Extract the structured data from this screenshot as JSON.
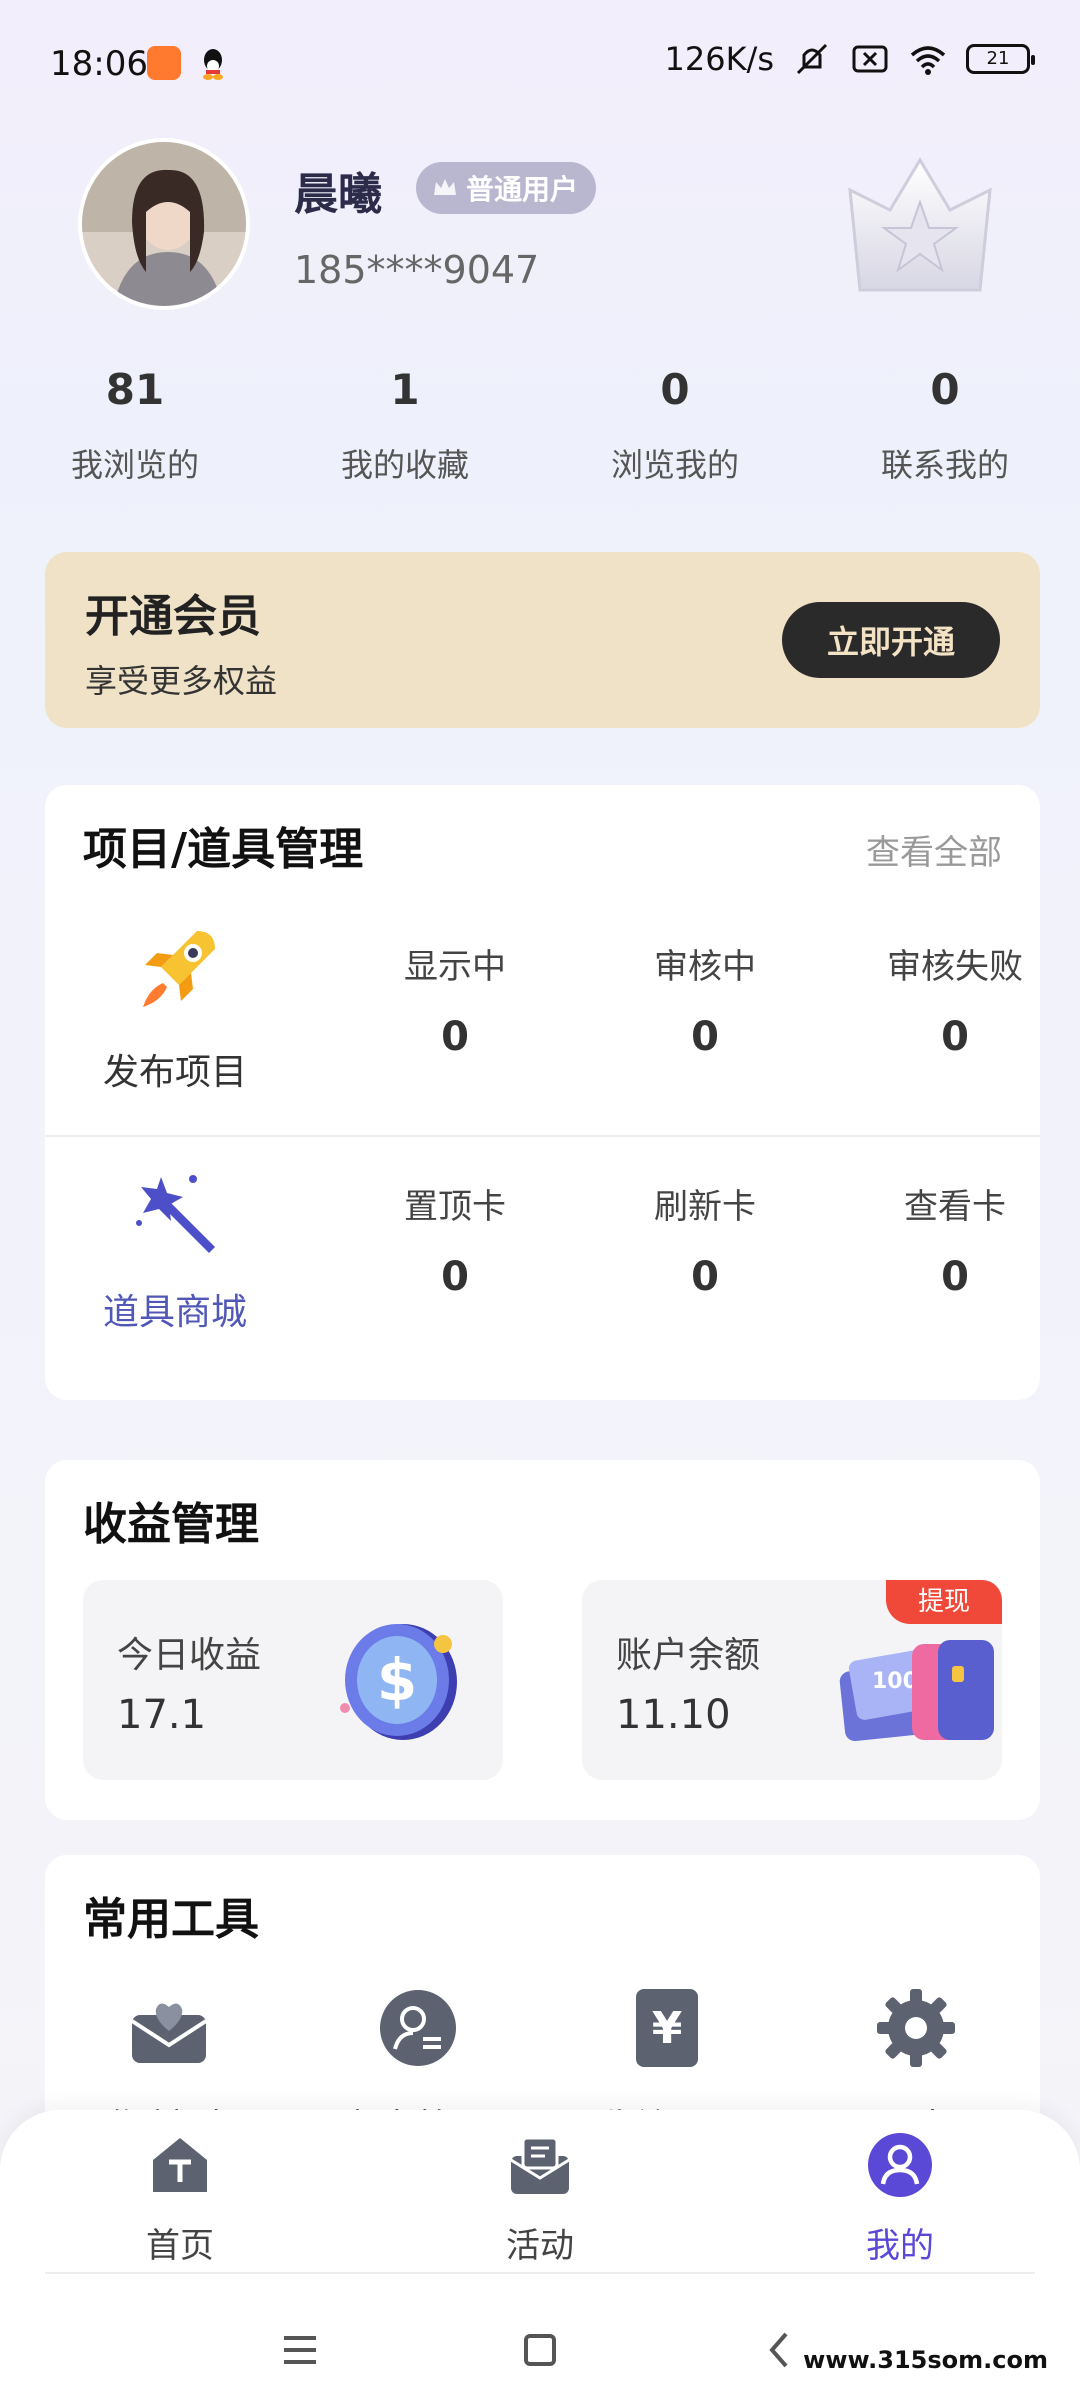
{
  "status_bar": {
    "time": "18:06",
    "network_speed": "126K/s",
    "battery": "21"
  },
  "profile": {
    "name": "晨曦",
    "badge": "普通用户",
    "phone": "185****9047"
  },
  "stats": [
    {
      "value": "81",
      "label": "我浏览的"
    },
    {
      "value": "1",
      "label": "我的收藏"
    },
    {
      "value": "0",
      "label": "浏览我的"
    },
    {
      "value": "0",
      "label": "联系我的"
    }
  ],
  "member": {
    "title": "开通会员",
    "subtitle": "享受更多权益",
    "button": "立即开通"
  },
  "projects": {
    "title": "项目/道具管理",
    "view_all": "查看全部",
    "publish": {
      "label": "发布项目",
      "stats": [
        {
          "label": "显示中",
          "value": "0"
        },
        {
          "label": "审核中",
          "value": "0"
        },
        {
          "label": "审核失败",
          "value": "0"
        }
      ]
    },
    "shop": {
      "label": "道具商城",
      "stats": [
        {
          "label": "置顶卡",
          "value": "0"
        },
        {
          "label": "刷新卡",
          "value": "0"
        },
        {
          "label": "查看卡",
          "value": "0"
        }
      ]
    }
  },
  "earnings": {
    "title": "收益管理",
    "today": {
      "label": "今日收益",
      "value": "17.1"
    },
    "balance": {
      "label": "账户余额",
      "value": "11.10",
      "tag": "提现"
    }
  },
  "tools": {
    "title": "常用工具",
    "items": [
      {
        "label": "邀请好友",
        "icon": "heart-envelope-icon"
      },
      {
        "label": "好友管理",
        "icon": "user-transfer-icon"
      },
      {
        "label": "收益记录",
        "icon": "yen-icon"
      },
      {
        "label": "设置中心",
        "icon": "gear-icon"
      }
    ]
  },
  "nav": [
    {
      "label": "首页",
      "icon": "home-icon"
    },
    {
      "label": "活动",
      "icon": "activity-icon"
    },
    {
      "label": "我的",
      "icon": "user-icon"
    }
  ],
  "watermark": "www.315som.com",
  "colors": {
    "accent": "#5a48d6",
    "member_bg": "#efe2c6",
    "withdraw_tag": "#f0493a"
  }
}
